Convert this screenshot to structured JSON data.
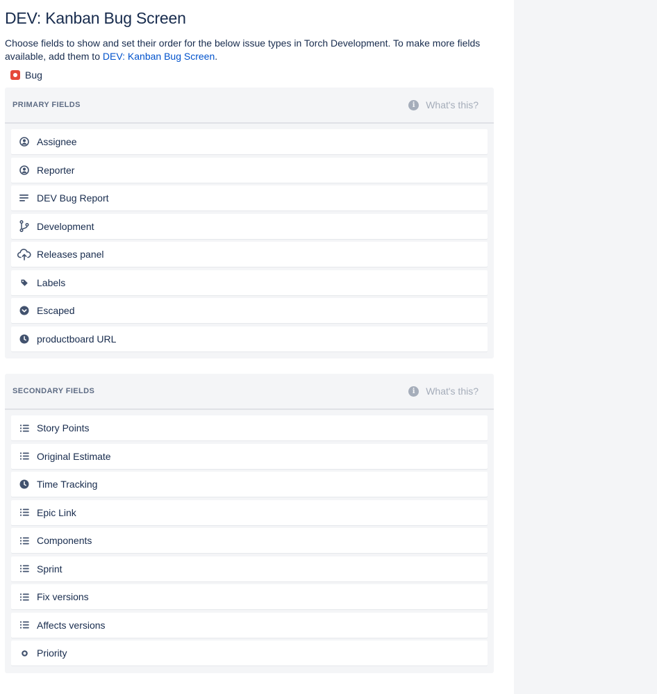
{
  "page": {
    "title": "DEV: Kanban Bug Screen",
    "description_prefix": "Choose fields to show and set their order for the below issue types in Torch Development. To make more fields available, add them to ",
    "description_link": "DEV: Kanban Bug Screen",
    "description_suffix": "."
  },
  "issue_type": {
    "label": "Bug",
    "icon": "bug-icon",
    "color": "#e5493a"
  },
  "primary": {
    "title": "PRIMARY FIELDS",
    "help": "What's this?",
    "fields": [
      {
        "label": "Assignee",
        "icon": "user-circle-icon"
      },
      {
        "label": "Reporter",
        "icon": "user-circle-icon"
      },
      {
        "label": "DEV Bug Report",
        "icon": "paragraph-icon"
      },
      {
        "label": "Development",
        "icon": "branch-icon"
      },
      {
        "label": "Releases panel",
        "icon": "cloud-upload-icon"
      },
      {
        "label": "Labels",
        "icon": "tag-icon"
      },
      {
        "label": "Escaped",
        "icon": "chevron-circle-icon"
      },
      {
        "label": "productboard URL",
        "icon": "clock-icon"
      }
    ]
  },
  "secondary": {
    "title": "SECONDARY FIELDS",
    "help": "What's this?",
    "fields": [
      {
        "label": "Story Points",
        "icon": "list-icon"
      },
      {
        "label": "Original Estimate",
        "icon": "list-icon"
      },
      {
        "label": "Time Tracking",
        "icon": "clock-icon"
      },
      {
        "label": "Epic Link",
        "icon": "list-icon"
      },
      {
        "label": "Components",
        "icon": "list-icon"
      },
      {
        "label": "Sprint",
        "icon": "list-icon"
      },
      {
        "label": "Fix versions",
        "icon": "list-icon"
      },
      {
        "label": "Affects versions",
        "icon": "list-icon"
      },
      {
        "label": "Priority",
        "icon": "dot-icon"
      }
    ]
  },
  "colors": {
    "link": "#0052cc",
    "text": "#172b4d",
    "section_bg": "#f4f5f7",
    "muted": "#a5adba"
  }
}
